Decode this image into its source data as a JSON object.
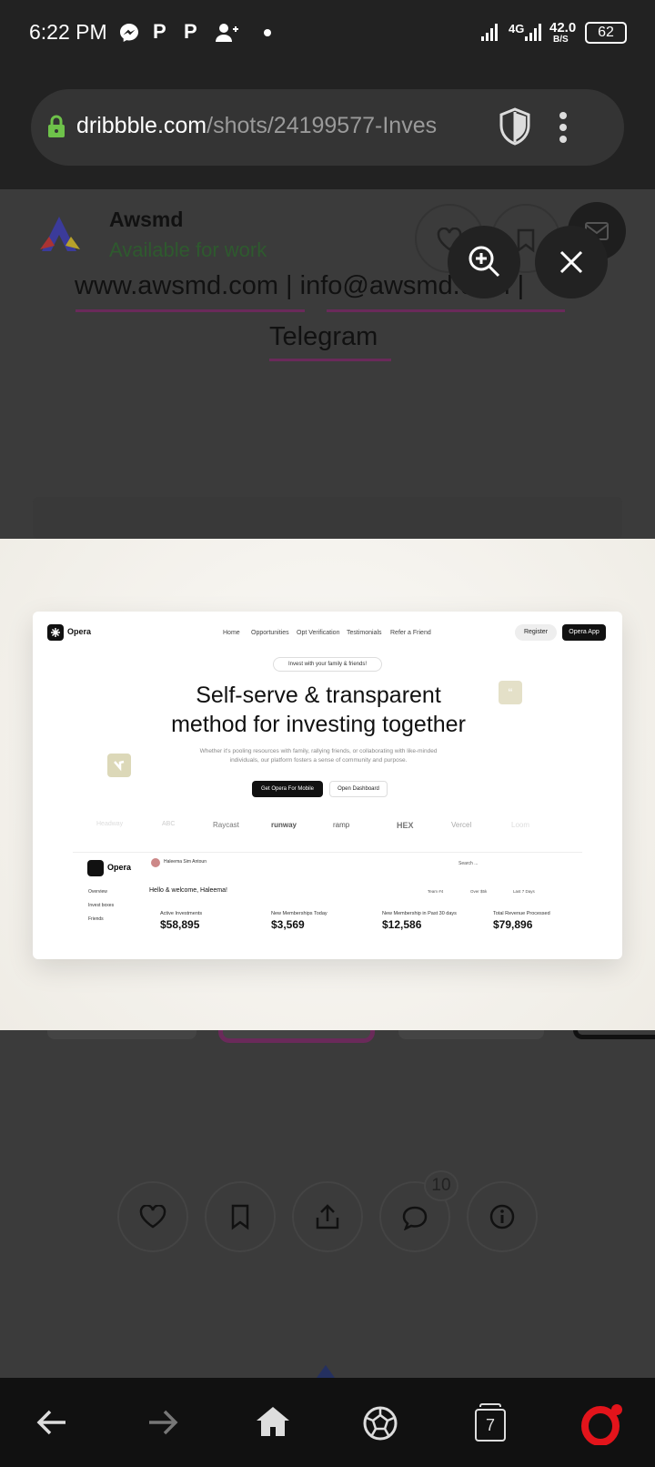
{
  "status": {
    "time": "6:22 PM",
    "network": "4G",
    "speed": "42.0",
    "speed_unit": "B/S",
    "battery": "62"
  },
  "browser": {
    "url_domain": "dribbble.com",
    "url_path": "/shots/24199577-Inves"
  },
  "profile": {
    "name": "Awsmd",
    "availability": "Available for work",
    "links": "www.awsmd.com | info@awsmd.com |",
    "telegram": "Telegram"
  },
  "mock": {
    "brand": "Opera",
    "nav": [
      "Home",
      "Opportunities",
      "Opt Verification",
      "Testimonials",
      "Refer a Friend"
    ],
    "register": "Register",
    "app_btn": "Opera App",
    "tagline": "Invest with your family & friends!",
    "headline1": "Self-serve & transparent",
    "headline2": "method for investing together",
    "sub1": "Whether it's pooling resources with family, rallying friends, or collaborating with like-minded",
    "sub2": "individuals, our platform fosters a sense of community and purpose.",
    "cta_mobile": "Get Opera For Mobile",
    "cta_dash": "Open Dashboard",
    "logos": [
      "Headway",
      "ABC",
      "Raycast",
      "runway",
      "ramp",
      "HEX",
      "Vercel",
      "Loom"
    ],
    "dash_user": "Haleema Sim Antoun",
    "dash_welcome": "Hello & welcome, Haleema!",
    "dash_search": "Search ...",
    "dash_filters": [
      "Team #4",
      "Over $5k",
      "Last 7 Days"
    ],
    "sidebar": [
      "Overview",
      "Invest boxes",
      "Friends"
    ],
    "stats": [
      {
        "label": "Active Investments",
        "value": "$58,895"
      },
      {
        "label": "New Memberships Today",
        "value": "$3,569"
      },
      {
        "label": "New Membership in Past 30 days",
        "value": "$12,586"
      },
      {
        "label": "Total Revenue Processed",
        "value": "$79,896"
      }
    ]
  },
  "comments_count": "10",
  "tabs_count": "7",
  "colors": {
    "accent": "#6a2a5a",
    "green": "#2e5a2e",
    "opera_red": "#e3141b"
  }
}
